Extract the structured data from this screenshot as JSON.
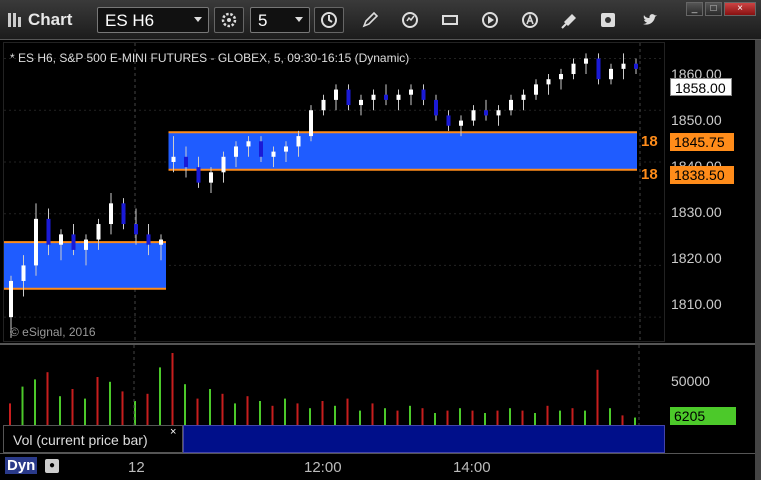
{
  "window": {
    "app_title": "Chart",
    "symbol": "ES H6",
    "interval": "5",
    "minimize": "_",
    "maximize": "□",
    "close": "×"
  },
  "chart": {
    "title": "* ES H6, S&P 500 E-MINI FUTURES - GLOBEX, 5, 09:30-16:15 (Dynamic)",
    "copyright": "© eSignal, 2016",
    "price_ticks": [
      "1860.00",
      "1850.00",
      "1840.00",
      "1830.00",
      "1820.00",
      "1810.00"
    ],
    "last_price": "1858.00",
    "zone_upper": {
      "count": "18",
      "price": "1845.75"
    },
    "zone_lower": {
      "count": "18",
      "price": "1838.50"
    },
    "volume_tick": "50000",
    "volume_last": "6205",
    "volume_legend": "Vol (current price bar)",
    "volume_legend_close": "×",
    "time_labels": [
      "12",
      "12:00",
      "14:00"
    ],
    "dyn_label": "Dyn",
    "colors": {
      "zone_fill": "#1f5cff",
      "zone_line": "#ff8c1a",
      "up_candle": "#ffffff",
      "down_candle": "#1a1ad6",
      "vol_up": "#4cc92a",
      "vol_down": "#c81e1e"
    }
  },
  "chart_data": {
    "type": "candlestick",
    "price_range": [
      1805,
      1863
    ],
    "candles": [
      [
        1810,
        1818,
        1806,
        1817
      ],
      [
        1817,
        1822,
        1814,
        1820
      ],
      [
        1820,
        1832,
        1818,
        1829
      ],
      [
        1829,
        1831,
        1822,
        1824
      ],
      [
        1824,
        1827,
        1821,
        1826
      ],
      [
        1826,
        1828,
        1822,
        1823
      ],
      [
        1823,
        1826,
        1820,
        1825
      ],
      [
        1825,
        1829,
        1823,
        1828
      ],
      [
        1828,
        1834,
        1826,
        1832
      ],
      [
        1832,
        1833,
        1827,
        1828
      ],
      [
        1828,
        1831,
        1824,
        1826
      ],
      [
        1826,
        1828,
        1822,
        1824
      ],
      [
        1824,
        1826,
        1821,
        1825
      ],
      [
        1840,
        1845,
        1838,
        1841
      ],
      [
        1841,
        1843,
        1837,
        1839
      ],
      [
        1839,
        1841,
        1835,
        1836
      ],
      [
        1836,
        1839,
        1834,
        1838
      ],
      [
        1838,
        1842,
        1836,
        1841
      ],
      [
        1841,
        1844,
        1839,
        1843
      ],
      [
        1843,
        1845,
        1841,
        1844
      ],
      [
        1844,
        1845,
        1840,
        1841
      ],
      [
        1841,
        1843,
        1839,
        1842
      ],
      [
        1842,
        1844,
        1840,
        1843
      ],
      [
        1843,
        1846,
        1841,
        1845
      ],
      [
        1845,
        1851,
        1844,
        1850
      ],
      [
        1850,
        1853,
        1849,
        1852
      ],
      [
        1852,
        1855,
        1850,
        1854
      ],
      [
        1854,
        1855,
        1850,
        1851
      ],
      [
        1851,
        1853,
        1849,
        1852
      ],
      [
        1852,
        1854,
        1850,
        1853
      ],
      [
        1853,
        1855,
        1851,
        1852
      ],
      [
        1852,
        1854,
        1850,
        1853
      ],
      [
        1853,
        1855,
        1851,
        1854
      ],
      [
        1854,
        1855,
        1851,
        1852
      ],
      [
        1852,
        1853,
        1848,
        1849
      ],
      [
        1849,
        1850,
        1846,
        1847
      ],
      [
        1847,
        1849,
        1845,
        1848
      ],
      [
        1848,
        1851,
        1847,
        1850
      ],
      [
        1850,
        1852,
        1848,
        1849
      ],
      [
        1849,
        1851,
        1847,
        1850
      ],
      [
        1850,
        1853,
        1849,
        1852
      ],
      [
        1852,
        1854,
        1850,
        1853
      ],
      [
        1853,
        1856,
        1852,
        1855
      ],
      [
        1855,
        1857,
        1853,
        1856
      ],
      [
        1856,
        1858,
        1854,
        1857
      ],
      [
        1857,
        1860,
        1856,
        1859
      ],
      [
        1859,
        1861,
        1857,
        1860
      ],
      [
        1860,
        1861,
        1855,
        1856
      ],
      [
        1856,
        1859,
        1855,
        1858
      ],
      [
        1858,
        1861,
        1856,
        1859
      ],
      [
        1859,
        1860,
        1857,
        1858
      ]
    ],
    "zones": [
      {
        "from_index": 0,
        "to_index": 12,
        "top": 1824.5,
        "bottom": 1815.5
      },
      {
        "from_index": 13,
        "to_index": 50,
        "top": 1845.75,
        "bottom": 1838.5
      }
    ],
    "volume_max": 60000,
    "volume": [
      [
        18000,
        0
      ],
      [
        32000,
        1
      ],
      [
        38000,
        1
      ],
      [
        44000,
        0
      ],
      [
        24000,
        1
      ],
      [
        30000,
        0
      ],
      [
        22000,
        1
      ],
      [
        40000,
        0
      ],
      [
        36000,
        1
      ],
      [
        28000,
        0
      ],
      [
        20000,
        1
      ],
      [
        26000,
        0
      ],
      [
        48000,
        1
      ],
      [
        60000,
        0
      ],
      [
        34000,
        1
      ],
      [
        22000,
        0
      ],
      [
        30000,
        1
      ],
      [
        26000,
        0
      ],
      [
        18000,
        1
      ],
      [
        24000,
        0
      ],
      [
        20000,
        1
      ],
      [
        16000,
        0
      ],
      [
        22000,
        1
      ],
      [
        18000,
        0
      ],
      [
        14000,
        1
      ],
      [
        20000,
        0
      ],
      [
        16000,
        1
      ],
      [
        22000,
        0
      ],
      [
        12000,
        1
      ],
      [
        18000,
        0
      ],
      [
        14000,
        1
      ],
      [
        12000,
        0
      ],
      [
        16000,
        1
      ],
      [
        14000,
        0
      ],
      [
        10000,
        1
      ],
      [
        12000,
        0
      ],
      [
        14000,
        1
      ],
      [
        12000,
        0
      ],
      [
        10000,
        1
      ],
      [
        12000,
        0
      ],
      [
        14000,
        1
      ],
      [
        12000,
        0
      ],
      [
        10000,
        1
      ],
      [
        16000,
        0
      ],
      [
        12000,
        1
      ],
      [
        14000,
        0
      ],
      [
        12000,
        1
      ],
      [
        46000,
        0
      ],
      [
        14000,
        1
      ],
      [
        8000,
        0
      ],
      [
        6205,
        1
      ]
    ]
  }
}
